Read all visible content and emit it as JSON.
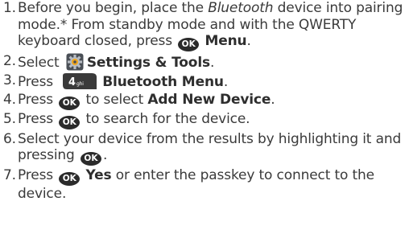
{
  "steps": [
    {
      "num": "1.",
      "text_a": "Before you begin, place the ",
      "italic": "Bluetooth",
      "text_b": " device into pairing mode.* From standby mode and with the QWERTY keyboard closed, press ",
      "ok_label": "OK",
      "bold": "Menu",
      "text_c": "."
    },
    {
      "num": "2.",
      "text_a": "Select ",
      "icon": "settings-gear-icon",
      "bold": "Settings & Tools",
      "text_b": "."
    },
    {
      "num": "3.",
      "text_a": "Press ",
      "icon": "key-4-ghi-icon",
      "key_digit": "4",
      "key_letters": "ghi",
      "bold": "Bluetooth Menu",
      "text_b": "."
    },
    {
      "num": "4.",
      "text_a": "Press ",
      "ok_label": "OK",
      "text_b": " to select ",
      "bold": "Add New Device",
      "text_c": "."
    },
    {
      "num": "5.",
      "text_a": "Press ",
      "ok_label": "OK",
      "text_b": " to search for the device."
    },
    {
      "num": "6.",
      "text_a": "Select your device from the results by highlighting it and pressing ",
      "ok_label": "OK",
      "text_b": "."
    },
    {
      "num": "7.",
      "text_a": "Press ",
      "ok_label": "OK",
      "bold": "Yes",
      "text_b": " or enter the passkey to connect to the device."
    }
  ],
  "colors": {
    "text": "#3a3a3a",
    "key_bg": "#2b2b2b",
    "gear_base": "#8a8f96",
    "gear_accent": "#f2a51a",
    "key4_bg": "#3a3a3a"
  }
}
